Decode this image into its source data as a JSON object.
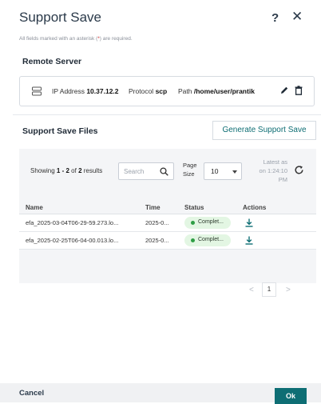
{
  "dialog": {
    "title": "Support Save",
    "help_glyph": "?",
    "close_glyph": "✕",
    "required_note_prefix": "All fields marked with an asterisk (",
    "required_note_star": "*",
    "required_note_suffix": ") are required."
  },
  "remote_server": {
    "section_title": "Remote Server",
    "ip_label": "IP Address",
    "ip_value": "10.37.12.2",
    "protocol_label": "Protocol",
    "protocol_value": "scp",
    "path_label": "Path",
    "path_value": "/home/user/prantik"
  },
  "files": {
    "section_title": "Support Save Files",
    "generate_button": "Generate Support Save",
    "showing_prefix": "Showing ",
    "showing_range": "1 - 2",
    "showing_of": " of ",
    "showing_total": "2",
    "showing_suffix": " results",
    "search_placeholder": "Search",
    "page_size_line1": "Page",
    "page_size_line2": "Size",
    "page_size_value": "10",
    "latest_line1": "Latest as",
    "latest_line2": "on 1:24:10",
    "latest_line3": "PM",
    "columns": {
      "name": "Name",
      "time": "Time",
      "status": "Status",
      "actions": "Actions"
    },
    "rows": [
      {
        "name": "efa_2025-03-04T06-29-59.273.lo...",
        "time": "2025-0...",
        "status": "Complet..."
      },
      {
        "name": "efa_2025-02-25T06-04-00.013.lo...",
        "time": "2025-0...",
        "status": "Complet..."
      }
    ],
    "pager": {
      "prev": "<",
      "current": "1",
      "next": ">"
    }
  },
  "footer": {
    "cancel": "Cancel",
    "ok": "Ok"
  },
  "colors": {
    "accent": "#0e6e74",
    "status_dot": "#2e9e44",
    "status_bg": "#e3f6e3",
    "required": "#d32f2f"
  },
  "icons": [
    "help-icon",
    "close-icon",
    "server-icon",
    "pencil-icon",
    "trash-icon",
    "search-icon",
    "refresh-icon",
    "download-icon"
  ]
}
